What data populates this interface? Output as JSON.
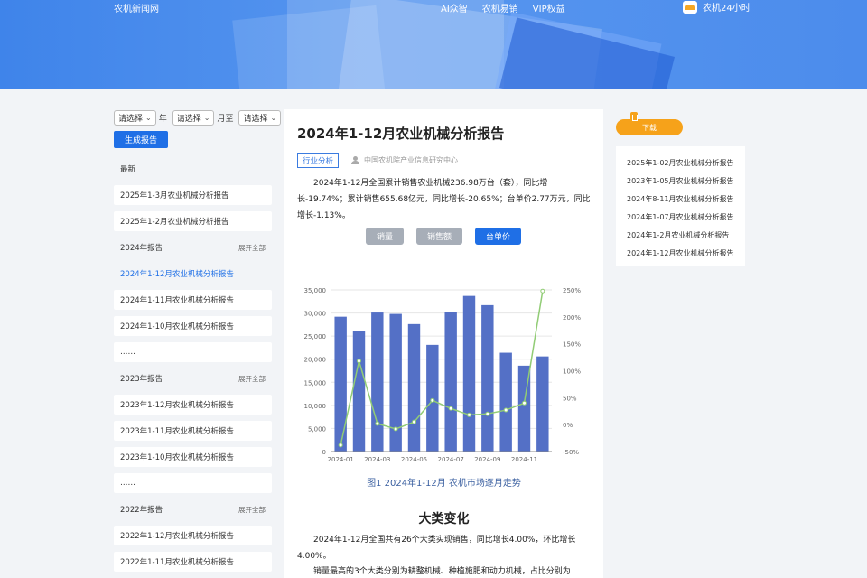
{
  "header": {
    "site_name": "农机新闻网",
    "nav": [
      "AI众智",
      "农机易销",
      "VIP权益"
    ],
    "badge_label": "农机24小时"
  },
  "filters": {
    "year_select": "请选择",
    "year_suffix": "年",
    "month_from_select": "请选择",
    "month_from_suffix": "月至",
    "month_to_select": "请选择",
    "month_to_suffix": "月",
    "generate_button": "生成报告"
  },
  "sidebar": {
    "items": [
      {
        "type": "head",
        "label": "最新",
        "expand": ""
      },
      {
        "type": "card",
        "label": "2025年1-3月农业机械分析报告",
        "expand": ""
      },
      {
        "type": "card",
        "label": "2025年1-2月农业机械分析报告",
        "expand": ""
      },
      {
        "type": "head",
        "label": "2024年报告",
        "expand": "展开全部"
      },
      {
        "type": "active",
        "label": "2024年1-12月农业机械分析报告",
        "expand": ""
      },
      {
        "type": "card",
        "label": "2024年1-11月农业机械分析报告",
        "expand": ""
      },
      {
        "type": "card",
        "label": "2024年1-10月农业机械分析报告",
        "expand": ""
      },
      {
        "type": "card",
        "label": "……",
        "expand": ""
      },
      {
        "type": "head",
        "label": "2023年报告",
        "expand": "展开全部"
      },
      {
        "type": "card",
        "label": "2023年1-12月农业机械分析报告",
        "expand": ""
      },
      {
        "type": "card",
        "label": "2023年1-11月农业机械分析报告",
        "expand": ""
      },
      {
        "type": "card",
        "label": "2023年1-10月农业机械分析报告",
        "expand": ""
      },
      {
        "type": "card",
        "label": "……",
        "expand": ""
      },
      {
        "type": "head",
        "label": "2022年报告",
        "expand": "展开全部"
      },
      {
        "type": "card",
        "label": "2022年1-12月农业机械分析报告",
        "expand": ""
      },
      {
        "type": "card",
        "label": "2022年1-11月农业机械分析报告",
        "expand": ""
      }
    ]
  },
  "article": {
    "title": "2024年1-12月农业机械分析报告",
    "tag": "行业分析",
    "author": "中国农机院产业信息研究中心",
    "summary": "2024年1-12月全国累计销售农业机械236.98万台（套），同比增长-19.74%；累计销售655.68亿元，同比增长-20.65%；台单价2.77万元，同比增长-1.13%。",
    "tabs": [
      "销量",
      "销售额",
      "台单价"
    ],
    "active_tab": 2,
    "figure_caption": "图1  2024年1-12月  农机市场逐月走势",
    "section_title": "大类变化",
    "para1": "2024年1-12月全国共有26个大类实现销售，同比增长4.00%，环比增长4.00%。",
    "para2": "销量最高的3个大类分别为耕整机械、种植施肥和动力机械，占比分别为"
  },
  "chart_data": {
    "type": "bar",
    "x": [
      "2024-01",
      "2024-02",
      "2024-03",
      "2024-04",
      "2024-05",
      "2024-06",
      "2024-07",
      "2024-08",
      "2024-09",
      "2024-10",
      "2024-11",
      "2024-12"
    ],
    "x_tick_labels": [
      "2024-01",
      "2024-03",
      "2024-05",
      "2024-07",
      "2024-09",
      "2024-11"
    ],
    "series": [
      {
        "kind": "bar",
        "values": [
          29200,
          26200,
          30100,
          29800,
          27600,
          23100,
          30300,
          33700,
          31700,
          21400,
          18600,
          20600
        ],
        "color": "#5470c6"
      },
      {
        "kind": "line",
        "axis": "right",
        "values": [
          -38,
          118,
          2,
          -8,
          5,
          45,
          30,
          18,
          20,
          27,
          40,
          248
        ],
        "color": "#91cc75"
      }
    ],
    "ylim": [
      0,
      35000
    ],
    "yticks": [
      "0",
      "5,000",
      "10,000",
      "15,000",
      "20,000",
      "25,000",
      "30,000",
      "35,000"
    ],
    "y2lim": [
      -50,
      250
    ],
    "y2ticks": [
      "-50%",
      "0%",
      "50%",
      "100%",
      "150%",
      "200%",
      "250%"
    ],
    "grid": true
  },
  "right_sidebar": {
    "download_label": "下载",
    "items": [
      "2025年1-02月农业机械分析报告",
      "2023年1-05月农业机械分析报告",
      "2024年8-11月农业机械分析报告",
      "2024年1-07月农业机械分析报告",
      "2024年1-2月农业机械分析报告",
      "2024年1-12月农业机械分析报告"
    ]
  }
}
